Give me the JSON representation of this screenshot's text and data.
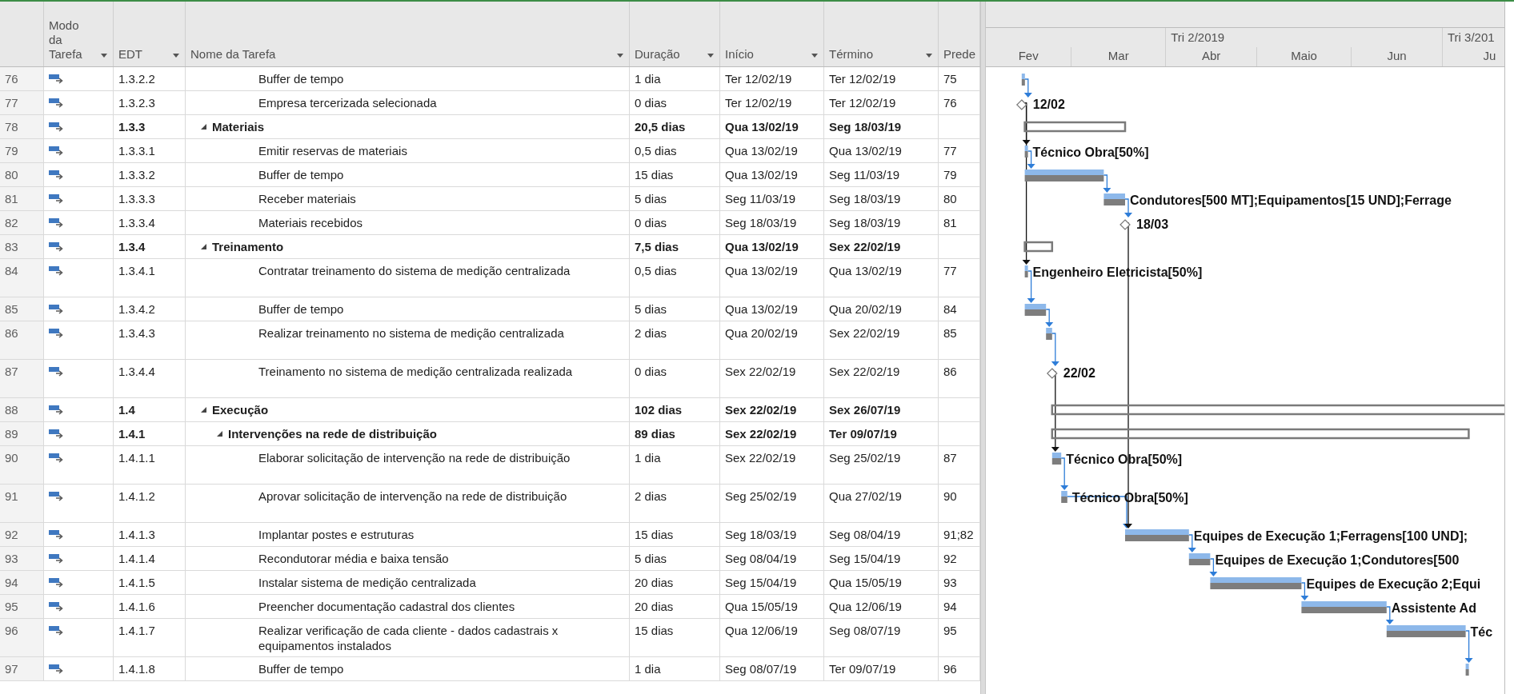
{
  "columns": [
    {
      "label": "Modo da Tarefa",
      "menu": true
    },
    {
      "label": "EDT",
      "menu": true
    },
    {
      "label": "Nome da Tarefa",
      "menu": true
    },
    {
      "label": "Duração",
      "menu": true
    },
    {
      "label": "Início",
      "menu": true
    },
    {
      "label": "Término",
      "menu": true
    },
    {
      "label": "Prede",
      "menu": false
    }
  ],
  "timescale": {
    "quarters": [
      {
        "label": "Tri 2/2019"
      },
      {
        "label": "Tri 3/201"
      }
    ],
    "months": [
      {
        "label": "Fev"
      },
      {
        "label": "Mar"
      },
      {
        "label": "Abr"
      },
      {
        "label": "Maio"
      },
      {
        "label": "Jun"
      },
      {
        "label": "Ju"
      }
    ]
  },
  "rows": [
    {
      "id": "76",
      "wbs": "1.3.2.2",
      "name": "Buffer de tempo",
      "duration": "1 dia",
      "start": "Ter 12/02/19",
      "finish": "Ter 12/02/19",
      "predecessors": "75",
      "kind": "task"
    },
    {
      "id": "77",
      "wbs": "1.3.2.3",
      "name": "Empresa tercerizada selecionada",
      "duration": "0 dias",
      "start": "Ter 12/02/19",
      "finish": "Ter 12/02/19",
      "predecessors": "76",
      "kind": "milestone",
      "bar_label": "12/02"
    },
    {
      "id": "78",
      "wbs": "1.3.3",
      "name": "Materiais",
      "duration": "20,5 dias",
      "start": "Qua 13/02/19",
      "finish": "Seg 18/03/19",
      "kind": "summary",
      "expanded": true,
      "children": [
        {
          "id": "79",
          "wbs": "1.3.3.1",
          "name": "Emitir reservas de materiais",
          "duration": "0,5 dias",
          "start": "Qua 13/02/19",
          "finish": "Qua 13/02/19",
          "predecessors": "77",
          "kind": "task",
          "bar_label": "Técnico Obra[50%]"
        },
        {
          "id": "80",
          "wbs": "1.3.3.2",
          "name": "Buffer de tempo",
          "duration": "15 dias",
          "start": "Qua 13/02/19",
          "finish": "Seg 11/03/19",
          "predecessors": "79",
          "kind": "task"
        },
        {
          "id": "81",
          "wbs": "1.3.3.3",
          "name": "Receber materiais",
          "duration": "5 dias",
          "start": "Seg 11/03/19",
          "finish": "Seg 18/03/19",
          "predecessors": "80",
          "kind": "task",
          "bar_label": "Condutores[500 MT];Equipamentos[15 UND];Ferrage"
        },
        {
          "id": "82",
          "wbs": "1.3.3.4",
          "name": "Materiais recebidos",
          "duration": "0 dias",
          "start": "Seg 18/03/19",
          "finish": "Seg 18/03/19",
          "predecessors": "81",
          "kind": "milestone",
          "bar_label": "18/03"
        }
      ]
    },
    {
      "id": "83",
      "wbs": "1.3.4",
      "name": "Treinamento",
      "duration": "7,5 dias",
      "start": "Qua 13/02/19",
      "finish": "Sex 22/02/19",
      "kind": "summary",
      "expanded": true,
      "children": [
        {
          "id": "84",
          "wbs": "1.3.4.1",
          "name": "Contratar treinamento do sistema de medição centralizada",
          "duration": "0,5 dias",
          "start": "Qua 13/02/19",
          "finish": "Qua 13/02/19",
          "predecessors": "77",
          "kind": "task",
          "bar_label": "Engenheiro Eletricista[50%]"
        },
        {
          "id": "85",
          "wbs": "1.3.4.2",
          "name": "Buffer de tempo",
          "duration": "5 dias",
          "start": "Qua 13/02/19",
          "finish": "Qua 20/02/19",
          "predecessors": "84",
          "kind": "task"
        },
        {
          "id": "86",
          "wbs": "1.3.4.3",
          "name": "Realizar treinamento no sistema de medição centralizada",
          "duration": "2 dias",
          "start": "Qua 20/02/19",
          "finish": "Sex 22/02/19",
          "predecessors": "85",
          "kind": "task"
        },
        {
          "id": "87",
          "wbs": "1.3.4.4",
          "name": "Treinamento no sistema de medição centralizada realizada",
          "duration": "0 dias",
          "start": "Sex 22/02/19",
          "finish": "Sex 22/02/19",
          "predecessors": "86",
          "kind": "milestone",
          "bar_label": "22/02"
        }
      ]
    },
    {
      "id": "88",
      "wbs": "1.4",
      "name": "Execução",
      "duration": "102 dias",
      "start": "Sex 22/02/19",
      "finish": "Sex 26/07/19",
      "kind": "summary",
      "expanded": true,
      "children": [
        {
          "id": "89",
          "wbs": "1.4.1",
          "name": "Intervenções na rede de distribuição",
          "duration": "89 dias",
          "start": "Sex 22/02/19",
          "finish": "Ter 09/07/19",
          "kind": "summary",
          "expanded": true,
          "children": [
            {
              "id": "90",
              "wbs": "1.4.1.1",
              "name": "Elaborar solicitação de intervenção na rede de distribuição",
              "duration": "1 dia",
              "start": "Sex 22/02/19",
              "finish": "Seg 25/02/19",
              "predecessors": "87",
              "kind": "task",
              "bar_label": "Técnico Obra[50%]"
            },
            {
              "id": "91",
              "wbs": "1.4.1.2",
              "name": "Aprovar solicitação de intervenção na rede de distribuição",
              "duration": "2 dias",
              "start": "Seg 25/02/19",
              "finish": "Qua 27/02/19",
              "predecessors": "90",
              "kind": "task",
              "bar_label": "Técnico Obra[50%]"
            },
            {
              "id": "92",
              "wbs": "1.4.1.3",
              "name": "Implantar postes e estruturas",
              "duration": "15 dias",
              "start": "Seg 18/03/19",
              "finish": "Seg 08/04/19",
              "predecessors": "91;82",
              "kind": "task",
              "bar_label": "Equipes de Execução 1;Ferragens[100 UND];"
            },
            {
              "id": "93",
              "wbs": "1.4.1.4",
              "name": "Recondutorar média e baixa tensão",
              "duration": "5 dias",
              "start": "Seg 08/04/19",
              "finish": "Seg 15/04/19",
              "predecessors": "92",
              "kind": "task",
              "bar_label": "Equipes de Execução 1;Condutores[500"
            },
            {
              "id": "94",
              "wbs": "1.4.1.5",
              "name": "Instalar sistema de medição centralizada",
              "duration": "20 dias",
              "start": "Seg 15/04/19",
              "finish": "Qua 15/05/19",
              "predecessors": "93",
              "kind": "task",
              "bar_label": "Equipes de Execução 2;Equi"
            },
            {
              "id": "95",
              "wbs": "1.4.1.6",
              "name": "Preencher documentação cadastral dos clientes",
              "duration": "20 dias",
              "start": "Qua 15/05/19",
              "finish": "Qua 12/06/19",
              "predecessors": "94",
              "kind": "task",
              "bar_label": "Assistente Ad"
            },
            {
              "id": "96",
              "wbs": "1.4.1.7",
              "name": "Realizar verificação de cada cliente - dados cadastrais x equipamentos instalados",
              "duration": "15 dias",
              "start": "Qua 12/06/19",
              "finish": "Seg 08/07/19",
              "predecessors": "95",
              "kind": "task",
              "bar_label": "Téc"
            },
            {
              "id": "97",
              "wbs": "1.4.1.8",
              "name": "Buffer de tempo",
              "duration": "1 dia",
              "start": "Seg 08/07/19",
              "finish": "Ter 09/07/19",
              "predecessors": "96",
              "kind": "task"
            }
          ]
        }
      ]
    }
  ]
}
